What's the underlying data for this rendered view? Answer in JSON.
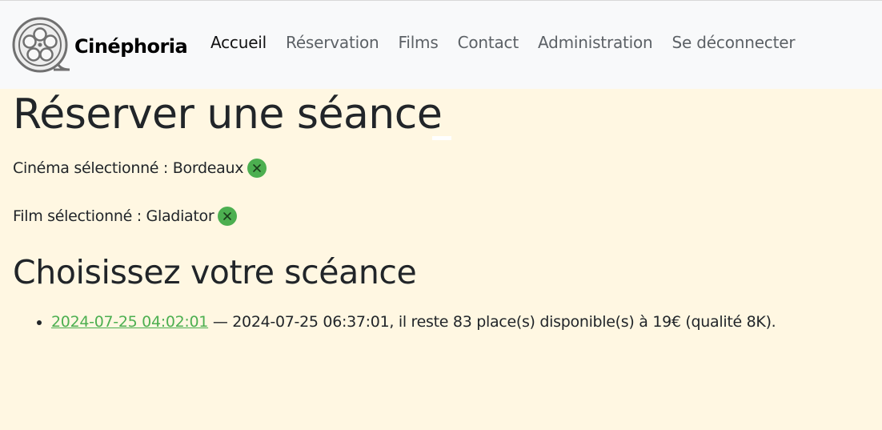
{
  "brand": {
    "name": "Cinéphoria",
    "logo_icon": "film-reel-icon"
  },
  "nav": {
    "items": [
      {
        "label": "Accueil",
        "active": true
      },
      {
        "label": "Réservation",
        "active": false
      },
      {
        "label": "Films",
        "active": false
      },
      {
        "label": "Contact",
        "active": false
      },
      {
        "label": "Administration",
        "active": false
      },
      {
        "label": "Se déconnecter",
        "active": false
      }
    ]
  },
  "page": {
    "title": "Réserver une séance",
    "cinema_label": "Cinéma sélectionné : Bordeaux",
    "film_label": "Film sélectionné : Gladiator",
    "clear_icon": "close-circle-icon",
    "section_title": "Choisissez votre scéance"
  },
  "sessions": [
    {
      "start": "2024-07-25 04:02:01",
      "details": " — 2024-07-25 06:37:01, il reste 83 place(s) disponible(s) à 19€ (qualité 8K)."
    }
  ],
  "colors": {
    "navbar_bg": "#f8f9fa",
    "page_bg": "#fff7e2",
    "accent_green": "#4caf50"
  }
}
